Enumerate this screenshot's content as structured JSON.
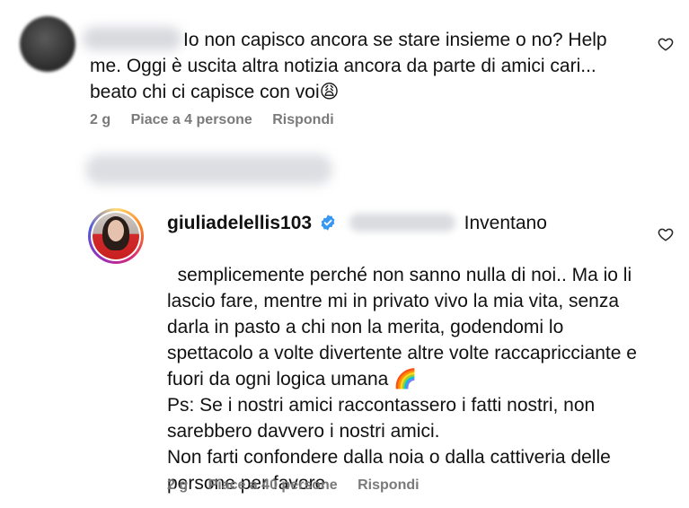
{
  "comment1": {
    "text": "Io non capisco ancora se stare insieme o no? Help me. Oggi è uscita altra notizia ancora da parte di amici cari... beato chi ci capisce con voi😩",
    "time": "2 g",
    "likes": "Piace a 4 persone",
    "reply": "Rispondi"
  },
  "reply": {
    "username": "giuliadelellis103",
    "text_first": "Inventano",
    "text_rest": "semplicemente perché non sanno nulla di noi.. Ma io li lascio fare, mentre mi in privato vivo la mia vita, senza darla in pasto a chi non la merita, godendomi lo spettacolo a volte divertente altre volte raccapricciante e fuori da ogni logica umana 🌈\nPs: Se i nostri amici raccontassero i fatti nostri, non sarebbero davvero i nostri amici.\nNon farti confondere dalla noia o dalla cattiveria delle persone per favore",
    "time": "2 g",
    "likes": "Piace a 40 persone",
    "reply": "Rispondi"
  },
  "icons": {
    "like": "heart-outline-icon",
    "verified": "verified-badge-icon"
  },
  "colors": {
    "verified": "#3897f0",
    "meta": "#7a7a7a"
  }
}
